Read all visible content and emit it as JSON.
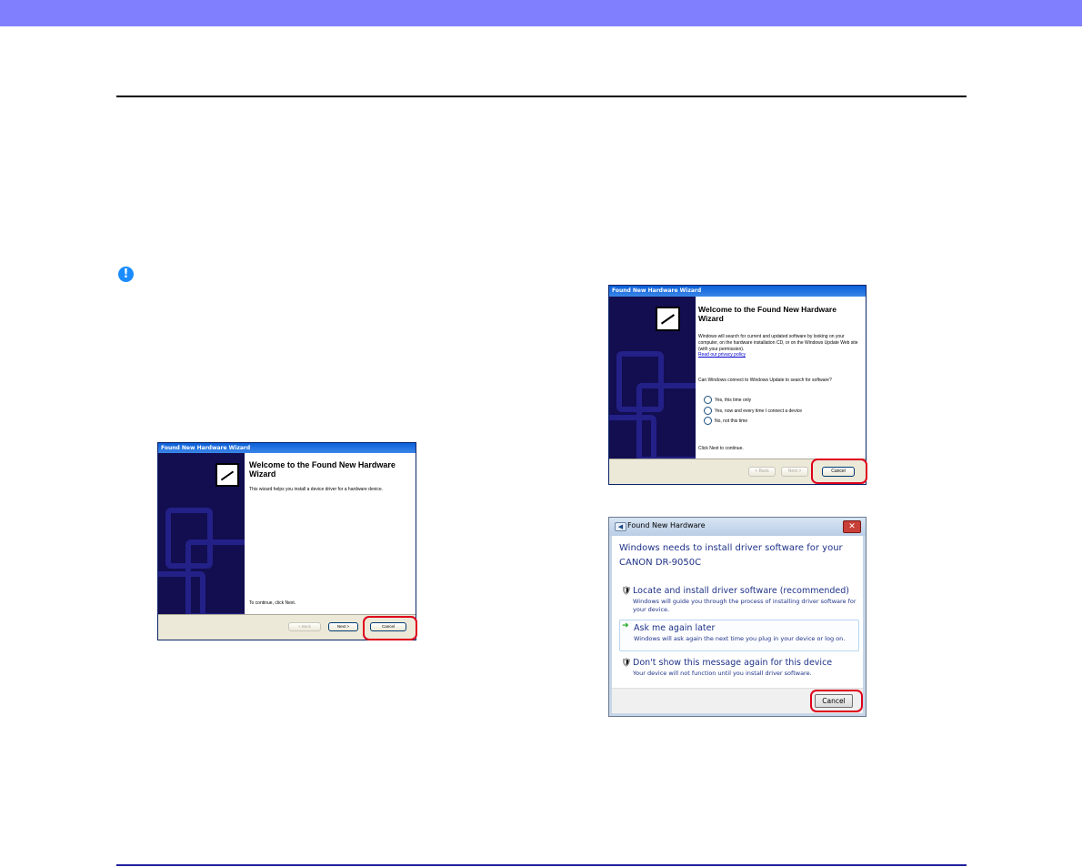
{
  "dialog_xp_small": {
    "title": "Found New Hardware Wizard",
    "heading": "Welcome to the Found New Hardware Wizard",
    "body": "This wizard helps you install a device driver for a hardware device.",
    "footer_note": "To continue, click Next.",
    "back_label": "< Back",
    "next_label": "Next >",
    "cancel_label": "Cancel"
  },
  "dialog_xp_large": {
    "title": "Found New Hardware Wizard",
    "heading": "Welcome to the Found New Hardware Wizard",
    "body": "Windows will search for current and updated software by looking on your computer, on the hardware installation CD, or on the Windows Update Web site (with your permission).",
    "privacy_link": "Read our privacy policy",
    "question": "Can Windows connect to Windows Update to search for software?",
    "options": [
      "Yes, this time only",
      "Yes, now and every time I connect a device",
      "No, not this time"
    ],
    "footer_note": "Click Next to continue.",
    "back_label": "< Back",
    "next_label": "Next >",
    "cancel_label": "Cancel"
  },
  "dialog_vista": {
    "title": "Found New Hardware",
    "heading": "Windows needs to install driver software for your CANON DR-9050C",
    "options": [
      {
        "title": "Locate and install driver software (recommended)",
        "desc": "Windows will guide you through the process of installing driver software for your device."
      },
      {
        "title": "Ask me again later",
        "desc": "Windows will ask again the next time you plug in your device or log on."
      },
      {
        "title": "Don't show this message again for this device",
        "desc": "Your device will not function until you install driver software."
      }
    ],
    "cancel_label": "Cancel"
  },
  "colors": {
    "header_bar": "#8080ff",
    "highlight": "#e0001b",
    "important_icon": "#1a8cff"
  },
  "icons": {
    "important": "exclamation-icon",
    "shield": "shield-icon",
    "arrow": "green-arrow-icon"
  }
}
